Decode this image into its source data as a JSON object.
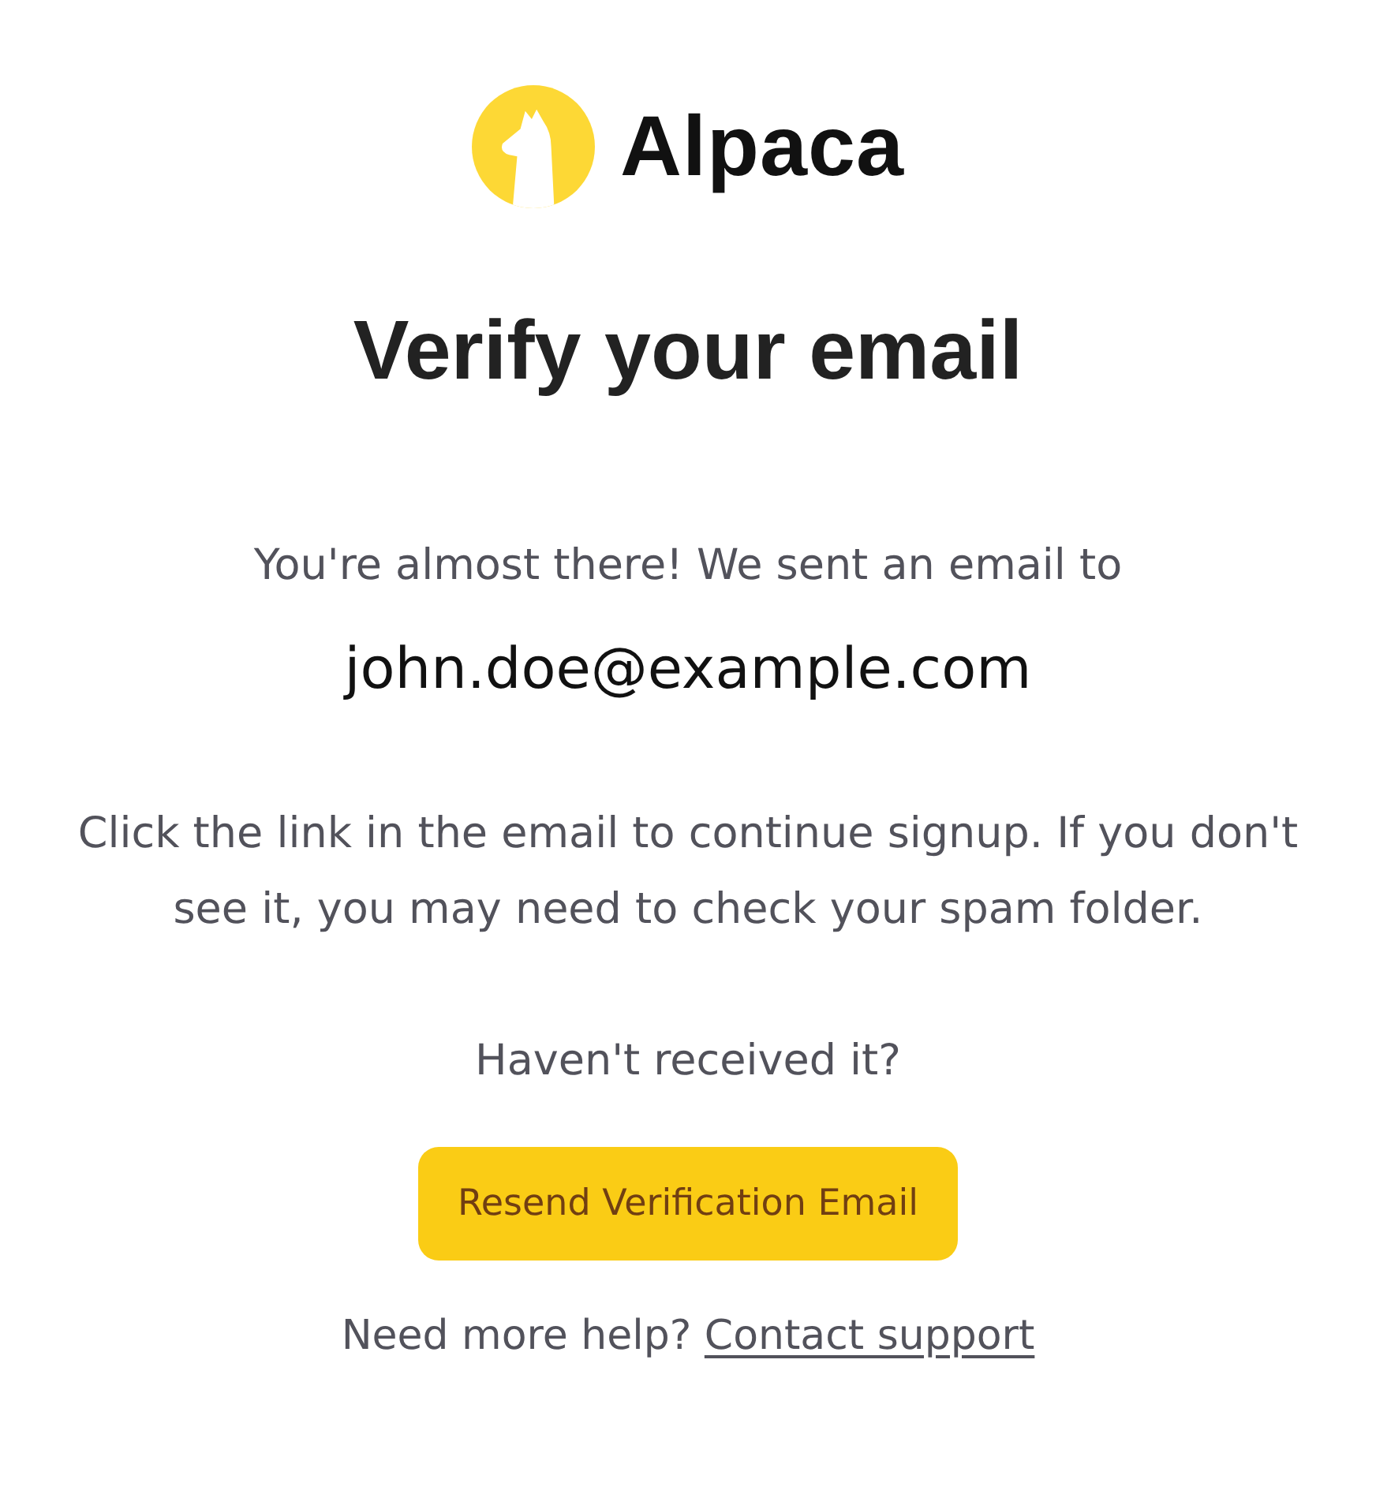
{
  "logo": {
    "text": "Alpaca"
  },
  "heading": "Verify your email",
  "intro": "You're almost there! We sent an email to",
  "email": "john.doe@example.com",
  "instructions": "Click the link in the email to continue signup. If you don't see it, you may need to check your spam folder.",
  "resend_prompt": "Haven't received it?",
  "resend_button": {
    "label": "Resend Verification Email"
  },
  "help": {
    "text": "Need more help?",
    "link": "Contact support"
  }
}
